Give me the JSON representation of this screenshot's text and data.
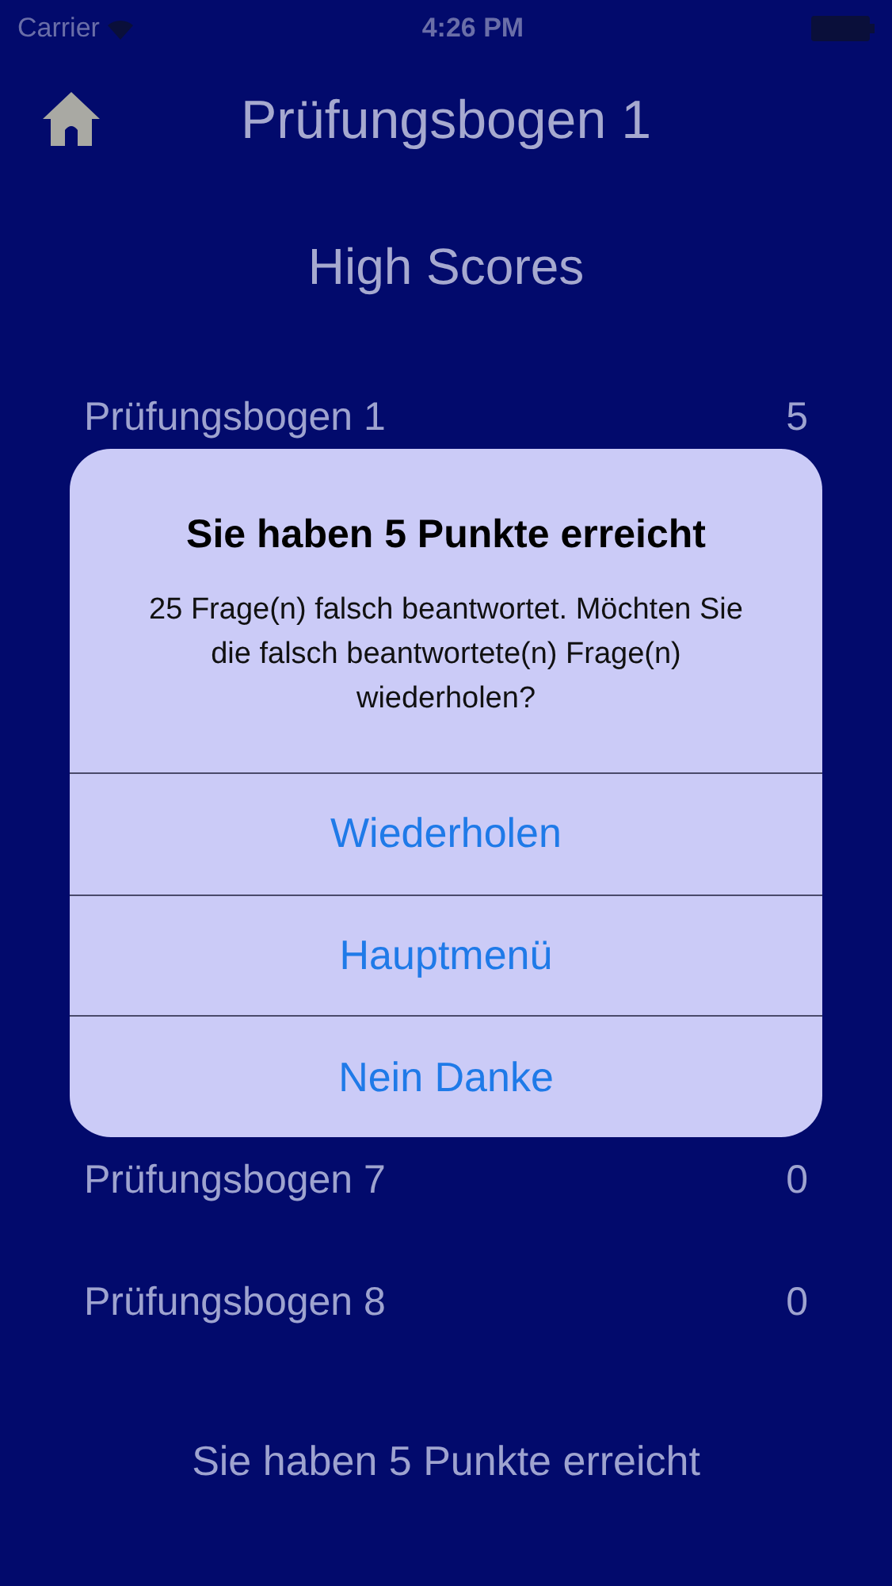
{
  "status_bar": {
    "carrier": "Carrier",
    "time": "4:26 PM"
  },
  "header": {
    "title": "Prüfungsbogen 1"
  },
  "section_title": "High Scores",
  "scores": [
    {
      "name": "Prüfungsbogen 1",
      "score": "5"
    },
    {
      "name": "Prüfungsbogen 7",
      "score": "0"
    },
    {
      "name": "Prüfungsbogen 8",
      "score": "0"
    }
  ],
  "footer": "Sie haben 5 Punkte erreicht",
  "alert": {
    "title": "Sie haben 5 Punkte erreicht",
    "message": "25 Frage(n) falsch beantwortet. Möchten Sie die falsch beantwortete(n) Frage(n) wiederholen?",
    "buttons": [
      "Wiederholen",
      "Hauptmenü",
      "Nein Danke"
    ]
  }
}
